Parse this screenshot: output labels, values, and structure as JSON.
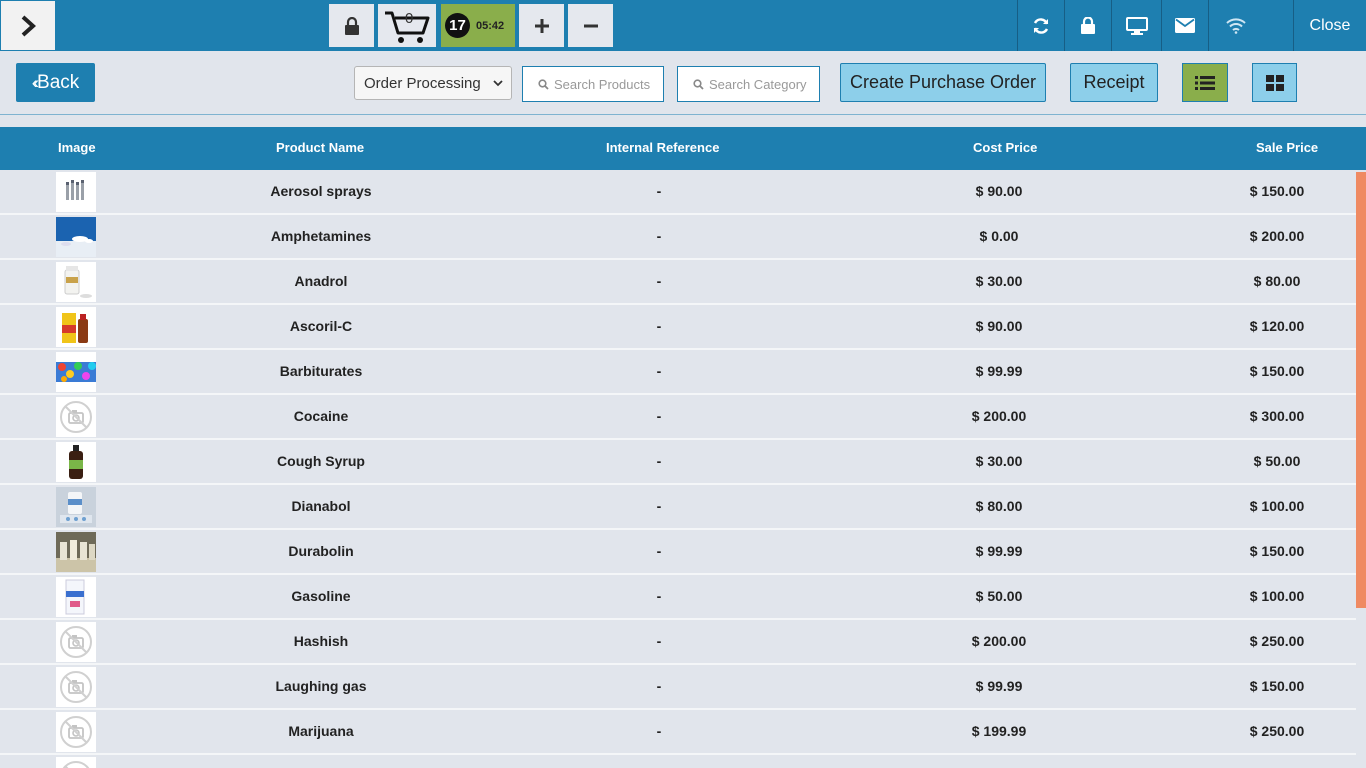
{
  "topbar": {
    "cart_count": "0",
    "order_number": "17",
    "timer": "05:42",
    "close_label": "Close"
  },
  "actionbar": {
    "back_label": "Back",
    "order_select_value": "Order Processing",
    "search_products_placeholder": "Search Products",
    "search_category_placeholder": "Search Category",
    "create_po_label": "Create Purchase Order",
    "receipt_label": "Receipt"
  },
  "table": {
    "headers": {
      "image": "Image",
      "name": "Product Name",
      "ref": "Internal Reference",
      "cost": "Cost Price",
      "sale": "Sale Price"
    },
    "rows": [
      {
        "name": "Aerosol sprays",
        "ref": "-",
        "cost": "$ 90.00",
        "sale": "$ 150.00",
        "image": "aerosol-bottles"
      },
      {
        "name": "Amphetamines",
        "ref": "-",
        "cost": "$ 0.00",
        "sale": "$ 200.00",
        "image": "pills-blue"
      },
      {
        "name": "Anadrol",
        "ref": "-",
        "cost": "$ 30.00",
        "sale": "$ 80.00",
        "image": "white-bottle"
      },
      {
        "name": "Ascoril-C",
        "ref": "-",
        "cost": "$ 90.00",
        "sale": "$ 120.00",
        "image": "syrup-box"
      },
      {
        "name": "Barbiturates",
        "ref": "-",
        "cost": "$ 99.99",
        "sale": "$ 150.00",
        "image": "colorful-pills"
      },
      {
        "name": "Cocaine",
        "ref": "-",
        "cost": "$ 200.00",
        "sale": "$ 300.00",
        "image": "no-image"
      },
      {
        "name": "Cough Syrup",
        "ref": "-",
        "cost": "$ 30.00",
        "sale": "$ 50.00",
        "image": "dark-bottle"
      },
      {
        "name": "Dianabol",
        "ref": "-",
        "cost": "$ 80.00",
        "sale": "$ 100.00",
        "image": "pill-bottle"
      },
      {
        "name": "Durabolin",
        "ref": "-",
        "cost": "$ 99.99",
        "sale": "$ 150.00",
        "image": "vials"
      },
      {
        "name": "Gasoline",
        "ref": "-",
        "cost": "$ 50.00",
        "sale": "$ 100.00",
        "image": "medicine-box"
      },
      {
        "name": "Hashish",
        "ref": "-",
        "cost": "$ 200.00",
        "sale": "$ 250.00",
        "image": "no-image"
      },
      {
        "name": "Laughing gas",
        "ref": "-",
        "cost": "$ 99.99",
        "sale": "$ 150.00",
        "image": "no-image"
      },
      {
        "name": "Marijuana",
        "ref": "-",
        "cost": "$ 199.99",
        "sale": "$ 250.00",
        "image": "no-image"
      },
      {
        "name": "",
        "ref": "",
        "cost": "",
        "sale": "",
        "image": "no-image"
      }
    ]
  },
  "colors": {
    "primary": "#1e7fb0",
    "timer_green": "#8aae4b",
    "light_blue_button": "#8dcfea",
    "scroll_thumb": "#ef8a62",
    "background": "#e1e5ec"
  },
  "icons": [
    "chevron-right-icon",
    "lock-icon",
    "cart-icon",
    "plus-icon",
    "minus-icon",
    "sync-icon",
    "monitor-icon",
    "mail-icon",
    "wifi-icon",
    "search-icon",
    "list-view-icon",
    "grid-view-icon",
    "caret-down-icon",
    "no-image-icon"
  ]
}
